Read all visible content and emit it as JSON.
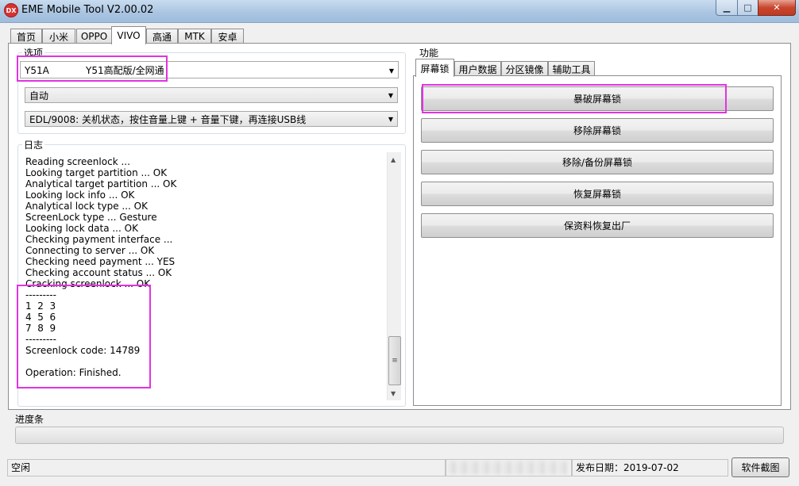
{
  "window": {
    "icon_text": "DX",
    "title": "EME Mobile Tool V2.00.02",
    "min_glyph": "▁",
    "max_glyph": "□",
    "close_glyph": "✕"
  },
  "main_tabs": [
    {
      "label": "首页"
    },
    {
      "label": "小米"
    },
    {
      "label": "OPPO"
    },
    {
      "label": "VIVO"
    },
    {
      "label": "高通"
    },
    {
      "label": "MTK"
    },
    {
      "label": "安卓"
    }
  ],
  "options": {
    "label": "选项",
    "model_code": "Y51A",
    "model_name": "Y51高配版/全网通",
    "mode_value": "自动",
    "boot_value": "EDL/9008: 关机状态，按住音量上键 + 音量下键，再连接USB线"
  },
  "log": {
    "label": "日志",
    "lines": [
      "Reading screenlock ...",
      "Looking target partition ... OK",
      "Analytical target partition ... OK",
      "Looking lock info ... OK",
      "Analytical lock type ... OK",
      "ScreenLock type ... Gesture",
      "Looking lock data ... OK",
      "Checking payment interface ...",
      "Connecting to server ... OK",
      "Checking need payment ... YES",
      "Checking account status ... OK",
      "Cracking screenlock ... OK",
      "---------",
      "1  2  3",
      "4  5  6",
      "7  8  9",
      "---------",
      "Screenlock code: 14789",
      "",
      "Operation: Finished."
    ]
  },
  "function": {
    "label": "功能",
    "tabs": [
      {
        "label": "屏幕锁"
      },
      {
        "label": "用户数据"
      },
      {
        "label": "分区镜像"
      },
      {
        "label": "辅助工具"
      }
    ],
    "buttons": [
      {
        "label": "暴破屏幕锁"
      },
      {
        "label": "移除屏幕锁"
      },
      {
        "label": "移除/备份屏幕锁"
      },
      {
        "label": "恢复屏幕锁"
      },
      {
        "label": "保资料恢复出厂"
      }
    ]
  },
  "progress": {
    "label": "进度条",
    "value": 0
  },
  "status": {
    "state": "空闲",
    "release_date": "发布日期：2019-07-02",
    "screenshot_button": "软件截图"
  }
}
